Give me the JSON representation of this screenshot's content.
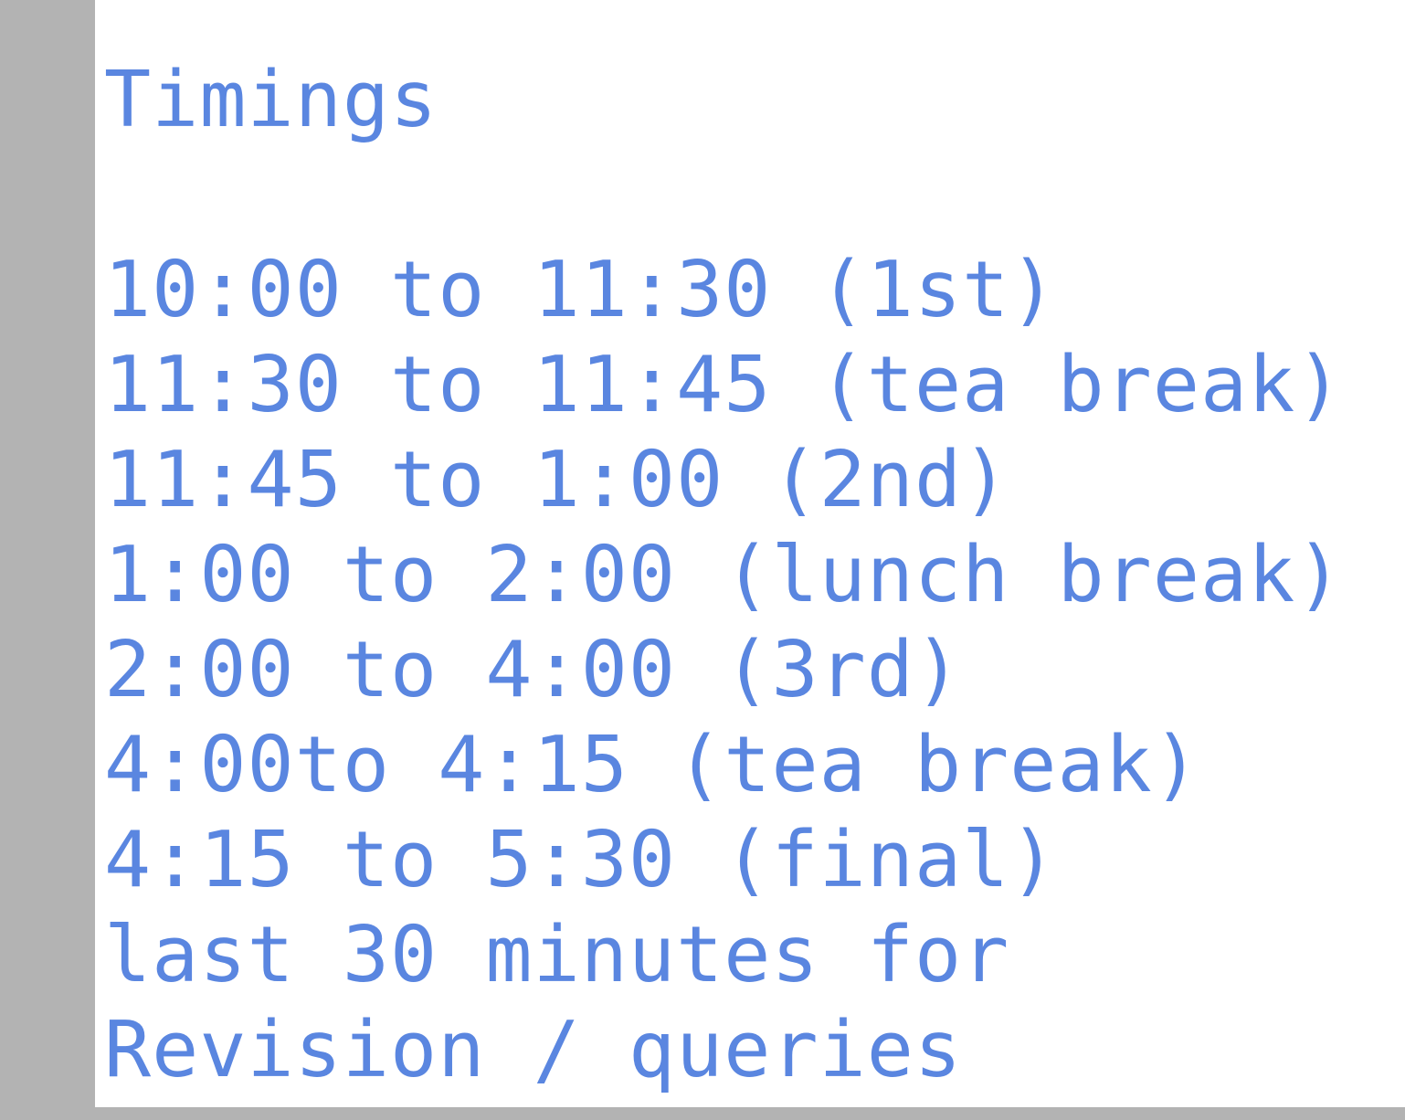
{
  "document": {
    "title": "Timings",
    "schedule": [
      "10:00 to 11:30 (1st)",
      "11:30 to 11:45 (tea break)",
      "11:45 to 1:00 (2nd)",
      "1:00 to 2:00 (lunch break)",
      "2:00 to 4:00 (3rd)",
      "4:00to 4:15 (tea break)",
      "4:15 to 5:30 (final)",
      "last 30 minutes for",
      "Revision / queries"
    ]
  },
  "colors": {
    "text": "#5a86e0",
    "page_background": "#ffffff",
    "frame_background": "#b3b3b3"
  }
}
